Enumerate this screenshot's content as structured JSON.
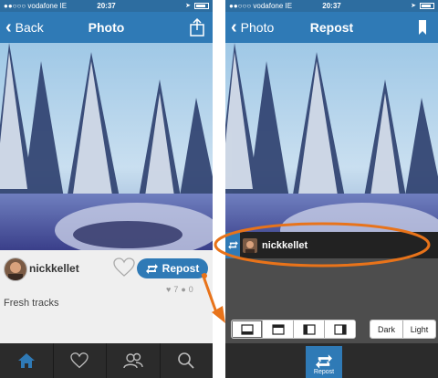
{
  "left": {
    "status": {
      "carrier": "●●○○○ vodafone IE",
      "time": "20:37"
    },
    "nav": {
      "back_label": "Back",
      "title": "Photo"
    },
    "profile": {
      "username": "nickkellet",
      "repost_label": "Repost"
    },
    "stats": {
      "likes": "7",
      "comments": "0"
    },
    "caption": "Fresh tracks",
    "tabs": [
      "home-icon",
      "heart-icon",
      "people-icon",
      "search-icon"
    ]
  },
  "right": {
    "status": {
      "carrier": "●●○○○ vodafone IE",
      "time": "20:37"
    },
    "nav": {
      "back_label": "Photo",
      "title": "Repost"
    },
    "banner": {
      "username": "nickkellet"
    },
    "theme": {
      "dark_label": "Dark",
      "light_label": "Light"
    },
    "repost_button_label": "Repost"
  },
  "colors": {
    "accent": "#2f7ab6",
    "highlight": "#e8731a"
  }
}
